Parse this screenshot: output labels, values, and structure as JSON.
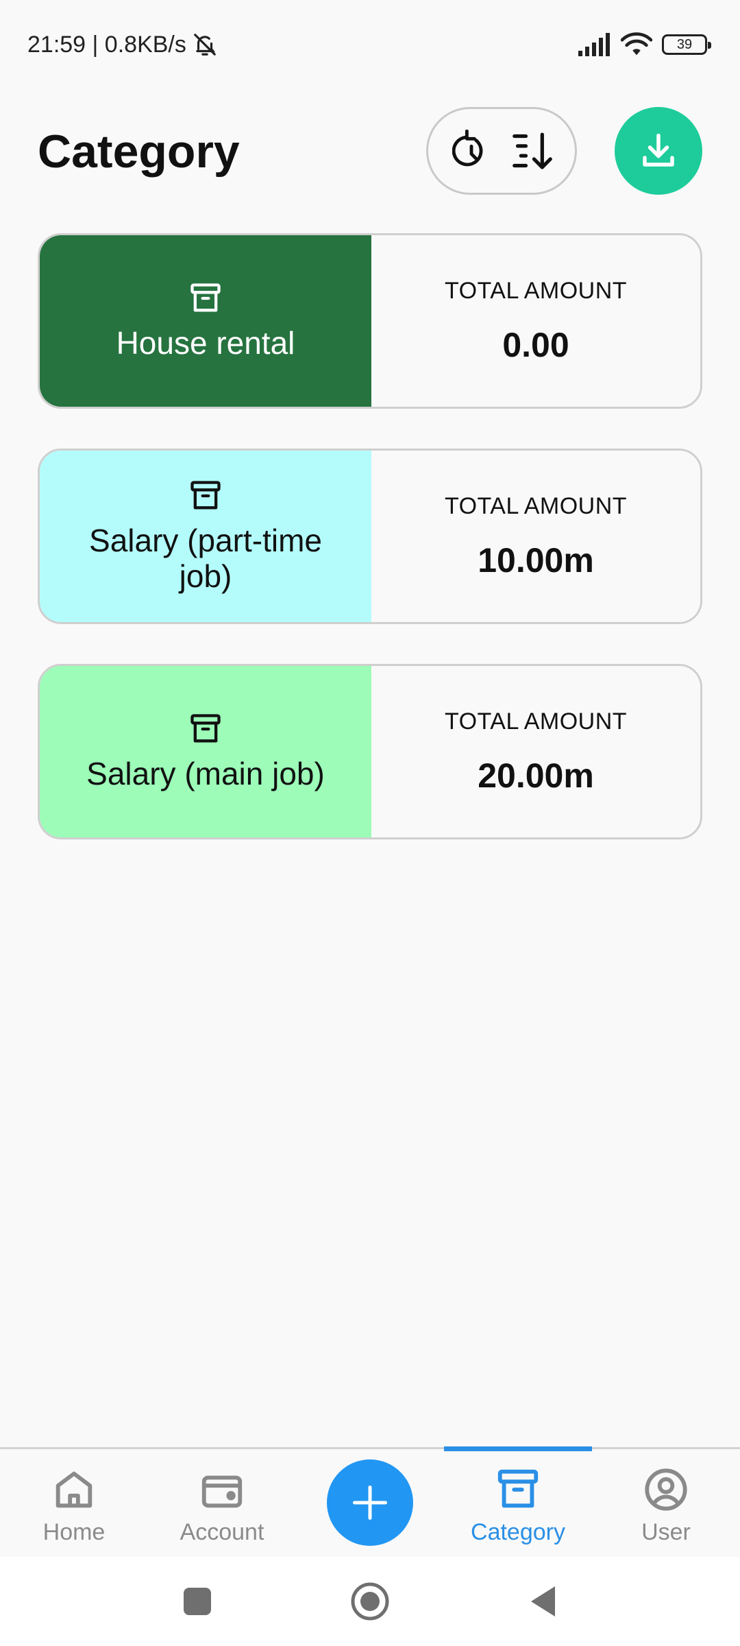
{
  "status_bar": {
    "time_speed": "21:59 | 0.8KB/s",
    "battery": "39"
  },
  "header": {
    "title": "Category"
  },
  "categories": [
    {
      "name": "House rental",
      "label": "TOTAL AMOUNT",
      "amount": "0.00",
      "color": "#26733f",
      "text_color": "#ffffff"
    },
    {
      "name": "Salary (part-time job)",
      "label": "TOTAL AMOUNT",
      "amount": "10.00m",
      "color": "#b4fcfc",
      "text_color": "#111111"
    },
    {
      "name": "Salary (main job)",
      "label": "TOTAL AMOUNT",
      "amount": "20.00m",
      "color": "#9cfcb8",
      "text_color": "#111111"
    }
  ],
  "bottom_nav": {
    "items": [
      {
        "label": "Home",
        "icon": "home-icon"
      },
      {
        "label": "Account",
        "icon": "wallet-icon"
      },
      {
        "label": "Category",
        "icon": "archive-icon",
        "active": true
      },
      {
        "label": "User",
        "icon": "user-icon"
      }
    ]
  },
  "colors": {
    "accent": "#2196f3",
    "download": "#1dcc9a"
  }
}
